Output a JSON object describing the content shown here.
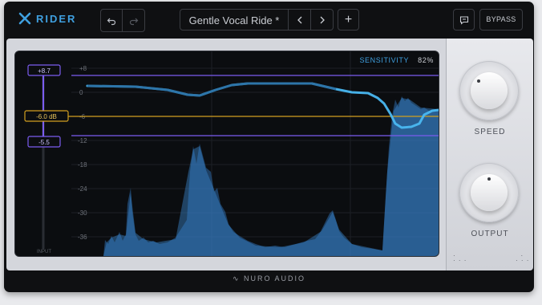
{
  "app": {
    "name": "RIDER",
    "brand_color": "#3fa0e0"
  },
  "toolbar": {
    "undo_icon": "undo-icon",
    "redo_icon": "redo-icon",
    "preset_name": "Gentle Vocal Ride *",
    "prev_icon": "chevron-left-icon",
    "next_icon": "chevron-right-icon",
    "add_label": "+",
    "chat_icon": "chat-icon",
    "bypass_label": "BYPASS"
  },
  "display": {
    "sensitivity_label": "SENSITIVITY",
    "sensitivity_value": "82%",
    "scale_labels": [
      "+8",
      "0",
      "-6",
      "-12",
      "-18",
      "-24",
      "-30",
      "-36"
    ],
    "range_max_label": "+8.7",
    "target_label": "-6.0 dB",
    "range_min_label": "-5.5",
    "input_label": "INPUT",
    "colors": {
      "range": "#7b5cf0",
      "target": "#d2a020",
      "curve": "#4ab8f2",
      "spectrum": "#2e6aa8"
    }
  },
  "knobs": {
    "speed_label": "SPEED",
    "output_label": "OUTPUT"
  },
  "footer": {
    "brand": "NURO AUDIO"
  }
}
